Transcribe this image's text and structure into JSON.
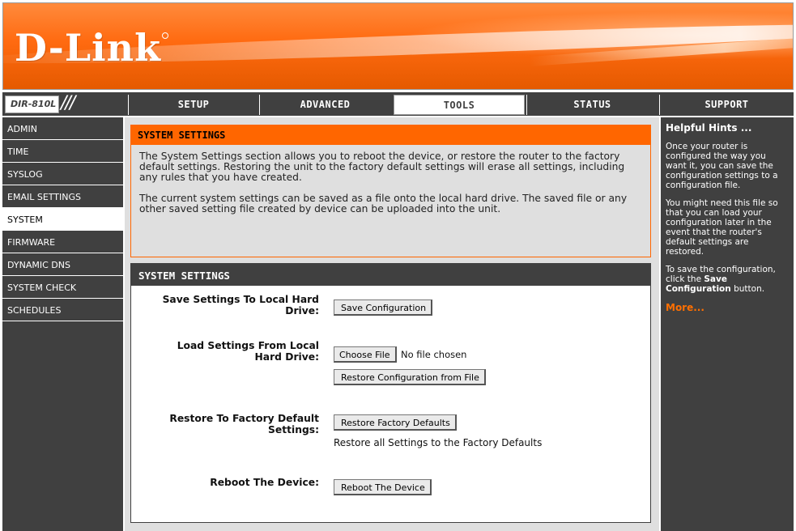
{
  "header": {
    "logo_text": "D-Link"
  },
  "nav": {
    "model": "DIR-810L",
    "tabs": [
      {
        "label": "SETUP"
      },
      {
        "label": "ADVANCED"
      },
      {
        "label": "TOOLS"
      },
      {
        "label": "STATUS"
      },
      {
        "label": "SUPPORT"
      }
    ],
    "active_tab": "TOOLS"
  },
  "sidebar": {
    "items": [
      {
        "label": "ADMIN"
      },
      {
        "label": "TIME"
      },
      {
        "label": "SYSLOG"
      },
      {
        "label": "EMAIL SETTINGS"
      },
      {
        "label": "SYSTEM"
      },
      {
        "label": "FIRMWARE"
      },
      {
        "label": "DYNAMIC DNS"
      },
      {
        "label": "SYSTEM CHECK"
      },
      {
        "label": "SCHEDULES"
      }
    ],
    "active_item": "SYSTEM"
  },
  "intro": {
    "title": "SYSTEM SETTINGS",
    "para1": "The System Settings section allows you to reboot the device, or restore the router to the factory default settings. Restoring the unit to the factory default settings will erase all settings, including any rules that you have created.",
    "para2": "The current system settings can be saved as a file onto the local hard drive. The saved file or any other saved setting file created by device can be uploaded into the unit."
  },
  "settings": {
    "title": "SYSTEM SETTINGS",
    "save": {
      "label_line1": "Save Settings To Local Hard",
      "label_line2": "Drive:",
      "button": "Save Configuration"
    },
    "load": {
      "label_line1": "Load Settings From Local",
      "label_line2": "Hard Drive:",
      "choose_button": "Choose File",
      "no_file": "No file chosen",
      "restore_button": "Restore Configuration from File"
    },
    "factory": {
      "label_line1": "Restore To Factory Default",
      "label_line2": "Settings:",
      "button": "Restore Factory Defaults",
      "note": "Restore all Settings to the Factory Defaults"
    },
    "reboot": {
      "label": "Reboot The Device:",
      "button": "Reboot The Device"
    }
  },
  "hints": {
    "title": "Helpful Hints ...",
    "p1": "Once your router is configured the way you want it, you can save the configuration settings to a configuration file.",
    "p2": "You might need this file so that you can load your configuration later in the event that the router's default settings are restored.",
    "p3_prefix": "To save the configuration, click the ",
    "p3_bold": "Save Configuration",
    "p3_suffix": " button.",
    "more": "More..."
  },
  "colors": {
    "accent": "#ff6600",
    "dark": "#404040",
    "panel": "#dfdfdf"
  }
}
